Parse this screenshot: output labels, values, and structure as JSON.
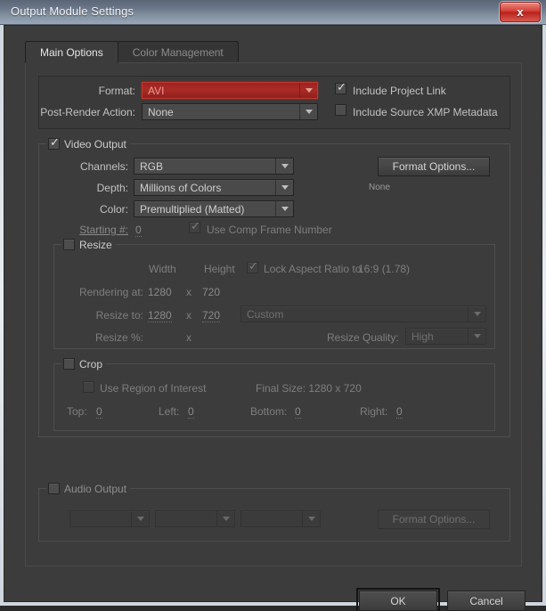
{
  "window": {
    "title": "Output Module Settings",
    "close_label": "✖"
  },
  "tabs": [
    {
      "label": "Main Options",
      "active": true
    },
    {
      "label": "Color Management",
      "active": false
    }
  ],
  "format_panel": {
    "format_label": "Format:",
    "format_value": "AVI",
    "post_render_label": "Post-Render Action:",
    "post_render_value": "None",
    "include_project_link": "Include Project Link",
    "include_xmp": "Include Source XMP Metadata"
  },
  "video_output": {
    "legend": "Video Output",
    "channels_label": "Channels:",
    "channels_value": "RGB",
    "depth_label": "Depth:",
    "depth_value": "Millions of Colors",
    "color_label": "Color:",
    "color_value": "Premultiplied (Matted)",
    "starting_label": "Starting #:",
    "starting_value": "0",
    "use_comp_frame": "Use Comp Frame Number",
    "format_options_button": "Format Options...",
    "format_options_status": "None"
  },
  "resize": {
    "legend": "Resize",
    "width_header": "Width",
    "height_header": "Height",
    "lock_aspect_label": "Lock Aspect Ratio to",
    "lock_aspect_value": "16:9 (1.78)",
    "rendering_at_label": "Rendering at:",
    "rendering_width": "1280",
    "rendering_x": "x",
    "rendering_height": "720",
    "resize_to_label": "Resize to:",
    "resize_width": "1280",
    "resize_x": "x",
    "resize_height": "720",
    "preset_value": "Custom",
    "resize_pct_label": "Resize %:",
    "resize_pct_x": "x",
    "quality_label": "Resize Quality:",
    "quality_value": "High"
  },
  "crop": {
    "legend": "Crop",
    "use_region_label": "Use Region of Interest",
    "final_size_label": "Final Size: 1280 x 720",
    "top_label": "Top:",
    "top_value": "0",
    "left_label": "Left:",
    "left_value": "0",
    "bottom_label": "Bottom:",
    "bottom_value": "0",
    "right_label": "Right:",
    "right_value": "0"
  },
  "audio_output": {
    "legend": "Audio Output",
    "rate_value": "",
    "depth_value": "",
    "channels_value": "",
    "format_options_button": "Format Options..."
  },
  "footer": {
    "ok": "OK",
    "cancel": "Cancel"
  },
  "colors": {
    "accent_red": "#ab2b25",
    "panel_bg": "#3c3c3c",
    "text": "#c2c2c2",
    "text_disabled": "#7e7e7e"
  }
}
